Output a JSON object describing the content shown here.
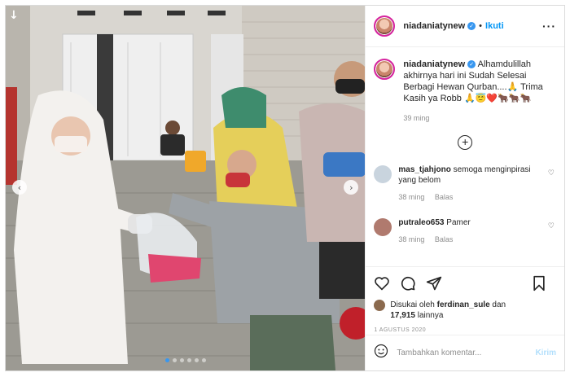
{
  "header": {
    "username": "niadaniatynew",
    "separator": "•",
    "follow_label": "Ikuti",
    "more_label": "···"
  },
  "caption": {
    "username": "niadaniatynew",
    "text": " Alhamdulillah akhirnya hari ini Sudah Selesai Berbagi Hewan Qurban....🙏 Trima Kasih ya Robb 🙏😇❤️🐂🐂🐂",
    "time": "39 ming"
  },
  "load_more": "+",
  "comments": [
    {
      "username": "mas_tjahjono",
      "text": " semoga menginpirasi yang belom",
      "time": "38 ming",
      "reply": "Balas",
      "avatar_color": "#c9d4de"
    },
    {
      "username": "putraleo653",
      "text": " Pamer",
      "time": "38 ming",
      "reply": "Balas",
      "avatar_color": "#b07a6e"
    }
  ],
  "likes": {
    "prefix": "Disukai oleh ",
    "user": "ferdinan_sule",
    "middle": " dan ",
    "count": "17,915",
    "suffix": " lainnya"
  },
  "date": "1 AGUSTUS 2020",
  "add_comment": {
    "placeholder": "Tambahkan komentar...",
    "post_label": "Kirim"
  },
  "photo": {
    "nav_left": "‹",
    "nav_right": "›",
    "download": "↓",
    "dots": 6,
    "active_dot": 0
  },
  "icons": [
    "heart-icon",
    "comment-icon",
    "share-icon",
    "bookmark-icon",
    "emoji-icon",
    "verified-icon"
  ]
}
